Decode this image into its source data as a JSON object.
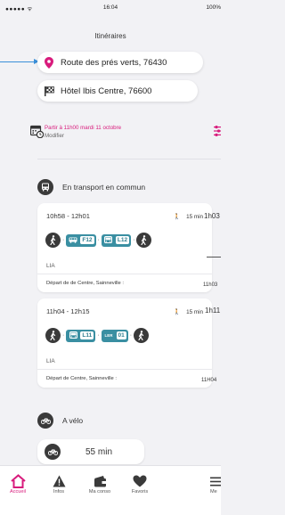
{
  "status": {
    "signal": "●●●●● ᯤ",
    "time": "16:04",
    "battery": "100%"
  },
  "header": {
    "title": "Itinéraires"
  },
  "route": {
    "from": "Route des prés verts, 76430",
    "to": "Hôtel Ibis Centre, 76600"
  },
  "departure": {
    "when": "Partir à 11h00 mardi 11 octobre",
    "modify": "Modifier"
  },
  "transit": {
    "label": "En transport en commun",
    "options": [
      {
        "times": "10h58 - 12h01",
        "walk": "15 min",
        "lines": [
          "F12",
          "L12"
        ],
        "operator": "LIA",
        "depart": "Départ de de Centre, Sainneville :",
        "right_time": "1h03",
        "right_dep": "11h03"
      },
      {
        "times": "11h04 - 12h15",
        "walk": "15 min",
        "lines": [
          "L11",
          "01"
        ],
        "line2_tag": "LER",
        "operator": "LIA",
        "depart": "Départ de Centre, Sainneville :",
        "right_time": "1h11",
        "right_dep": "11H04"
      }
    ]
  },
  "bike": {
    "label": "A vélo",
    "duration": "55 min"
  },
  "tabs": [
    {
      "label": "Accueil",
      "icon": "home-icon"
    },
    {
      "label": "Infos",
      "icon": "warning-icon"
    },
    {
      "label": "Ma conso",
      "icon": "wallet-icon"
    },
    {
      "label": "Favoris",
      "icon": "heart-icon"
    },
    {
      "label": "Me",
      "icon": "menu-icon"
    }
  ],
  "colors": {
    "accent": "#d81b7c",
    "line": "#3a8fa2",
    "arrow": "#3b8fd9"
  }
}
